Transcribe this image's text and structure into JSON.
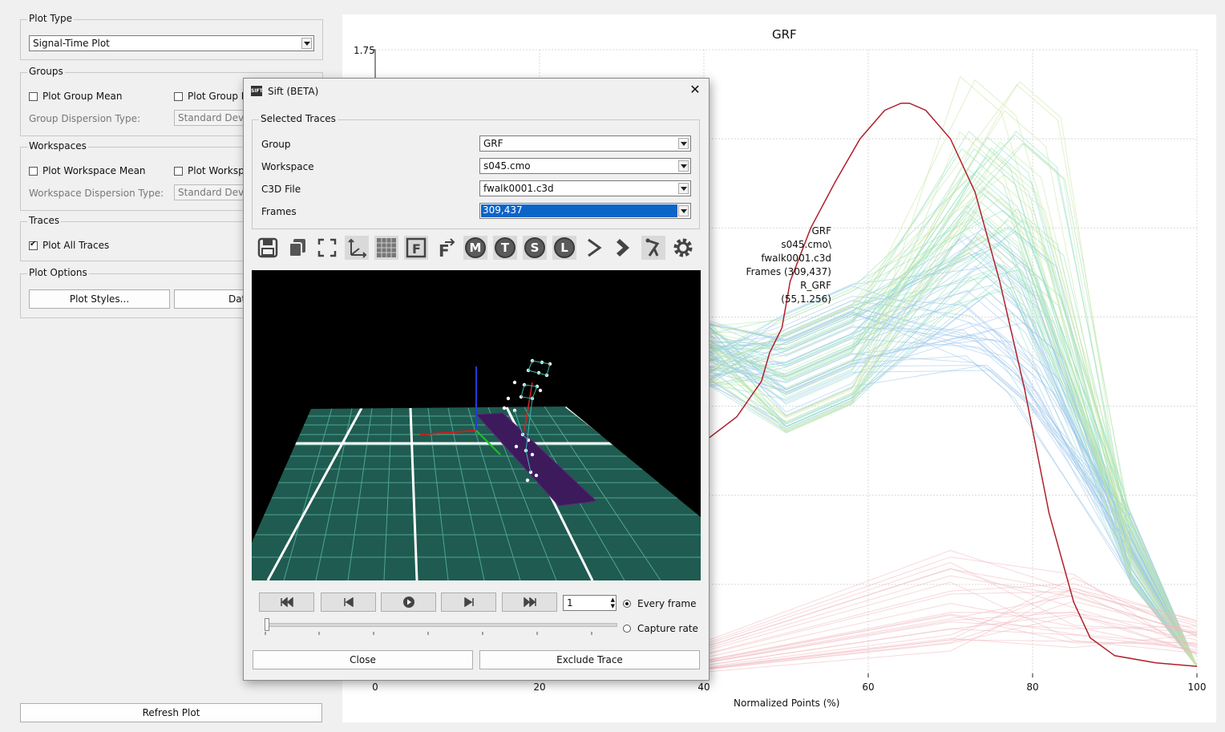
{
  "left_panel": {
    "plot_type": {
      "title": "Plot Type",
      "value": "Signal-Time Plot"
    },
    "groups": {
      "title": "Groups",
      "plot_group_mean": "Plot Group Mean",
      "plot_group_dispersion": "Plot Group D",
      "dispersion_type_label": "Group Dispersion Type:",
      "dispersion_type_value": "Standard Deviat"
    },
    "workspaces": {
      "title": "Workspaces",
      "plot_workspace_mean": "Plot Workspace Mean",
      "plot_workspace_dispersion": "Plot Workspa",
      "dispersion_type_label": "Workspace Dispersion Type:",
      "dispersion_type_value": "Standard Deviat"
    },
    "traces": {
      "title": "Traces",
      "plot_all_traces": "Plot All Traces"
    },
    "plot_options": {
      "title": "Plot Options",
      "plot_styles": "Plot Styles...",
      "data": "Data S"
    },
    "refresh": "Refresh Plot"
  },
  "chart": {
    "title": "GRF",
    "xlabel": "Normalized Points (%)",
    "y_top_tick": "1.75",
    "x_ticks": [
      "0",
      "20",
      "40",
      "60",
      "80",
      "100"
    ],
    "tooltip": [
      "GRF",
      "s045.cmo\\",
      "fwalk0001.c3d",
      "Frames (309,437)",
      "R_GRF",
      "(55,1.256)"
    ]
  },
  "chart_data": {
    "type": "line",
    "title": "GRF",
    "xlabel": "Normalized Points (%)",
    "ylabel": "",
    "xlim": [
      0,
      100
    ],
    "x_ticks": [
      0,
      20,
      40,
      60,
      80,
      100
    ],
    "y_top_tick": 1.75,
    "series": [
      {
        "role": "highlighted",
        "color": "#b0202a",
        "x": [
          40,
          44,
          47,
          48,
          49.5,
          50.5,
          53,
          56,
          59,
          62,
          64,
          65,
          67,
          70,
          73,
          76,
          79,
          82,
          85,
          87,
          90,
          95,
          100
        ],
        "y": [
          0.65,
          0.72,
          0.82,
          0.9,
          0.97,
          1.1,
          1.25,
          1.38,
          1.5,
          1.58,
          1.6,
          1.6,
          1.58,
          1.5,
          1.35,
          1.1,
          0.8,
          0.45,
          0.2,
          0.1,
          0.05,
          0.03,
          0.02
        ]
      }
    ],
    "background_traces": [
      {
        "color": "#8fe0c0",
        "count": 40
      },
      {
        "color": "#9cc7ec",
        "count": 40
      },
      {
        "color": "#c7e6a0",
        "count": 20
      },
      {
        "color": "#f0b8c0",
        "count": 25
      }
    ]
  },
  "sift": {
    "title": "Sift (BETA)",
    "selected_traces": "Selected Traces",
    "rows": [
      {
        "label": "Group",
        "value": "GRF"
      },
      {
        "label": "Workspace",
        "value": "s045.cmo"
      },
      {
        "label": "C3D File",
        "value": "fwalk0001.c3d"
      },
      {
        "label": "Frames",
        "value": "309,437"
      }
    ],
    "toolbar": {
      "m": "M",
      "t": "T",
      "s": "S",
      "l": "L"
    },
    "frame_step": "1",
    "every_frame": "Every frame",
    "capture_rate": "Capture rate",
    "close": "Close",
    "exclude": "Exclude Trace"
  }
}
